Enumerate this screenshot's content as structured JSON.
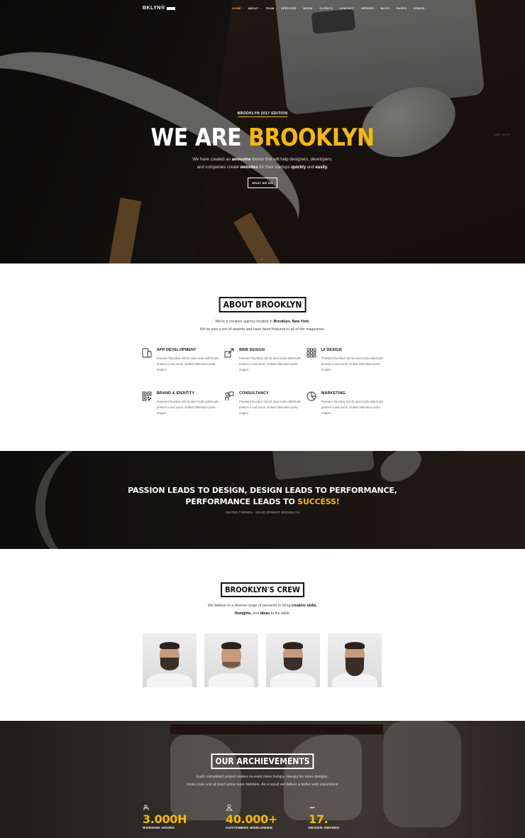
{
  "nav": {
    "logo": "BKLYN",
    "logo_suffix": "®",
    "items": [
      "HOME",
      "ABOUT",
      "TEAM",
      "SERVICES",
      "WORK",
      "CLIENTS",
      "CONTACT",
      "HEROES",
      "BLOG",
      "PAGES",
      "DEMOS"
    ],
    "active": "HOME"
  },
  "hero": {
    "edition": "BROOKLYN 2017 EDITION",
    "title_plain": "WE ARE ",
    "title_highlight": "BROOKLYN",
    "sub": {
      "line1_a": "We have created an ",
      "line1_b": "awesome",
      "line1_c": " theme that will help designers, developers,",
      "line2_a": "and companies create ",
      "line2_b": "websites",
      "line2_c": " for their startups ",
      "line2_d": "quickly",
      "line2_e": " and ",
      "line2_f": "easily."
    },
    "button": "WHAT WE DO",
    "side_label": "SEE NEXT",
    "scroll_icon": "chevron-down-icon",
    "accent": "#f5b80c"
  },
  "about": {
    "title": "ABOUT BROOKLYN",
    "line1_a": "We're a creative agency located in ",
    "line1_b": "Brooklyn, New York.",
    "line2": "We've won a ton of awards and have been featured in all of the magazines.",
    "services": [
      {
        "icon": "mobile-devices-icon",
        "title": "APP DEVELOPMENT",
        "text": "Praesent faucibus nisl sit amet nulla sollicitudin pretium a sed purus. Nullam bibendum porta magna."
      },
      {
        "icon": "resize-arrow-icon",
        "title": "WEB DESIGN",
        "text": "Praesent faucibus nisl sit amet nulla sollicitudin pretium a sed purus. Nullam bibendum porta magna."
      },
      {
        "icon": "grid-icon",
        "title": "UI DESIGN",
        "text": "Praesent faucibus nisl sit amet nulla sollicitudin pretium a sed purus. Nullam bibendum porta magna."
      },
      {
        "icon": "qr-code-icon",
        "title": "BRAND & IDENTITY",
        "text": "Praesent faucibus nisl sit amet nulla sollicitudin pretium a sed purus. Nullam bibendum porta magna."
      },
      {
        "icon": "presenter-icon",
        "title": "CONSULTANCY",
        "text": "Praesent faucibus nisl sit amet nulla sollicitudin pretium a sed purus. Nullam bibendum porta magna."
      },
      {
        "icon": "pie-chart-icon",
        "title": "MARKETING",
        "text": "Praesent faucibus nisl sit amet nulla sollicitudin pretium a sed purus. Nullam bibendum porta magna."
      }
    ]
  },
  "quote": {
    "line1": "PASSION LEADS TO DESIGN, DESIGN LEADS TO PERFORMANCE,",
    "line2_plain": "PERFORMANCE LEADS TO ",
    "line2_highlight": "SUCCESS!",
    "cite": "UNITED THEMES - DEVELOPMENT BROOKLYN"
  },
  "crew": {
    "title": "BROOKLYN'S CREW",
    "line1_a": "We believe in a diverse range of personel to bring ",
    "line1_b": "creative skills,",
    "line2_a": "thoughts,",
    "line2_b": " and ",
    "line2_c": "ideas",
    "line2_d": " to the table.",
    "members": [
      "member-1",
      "member-2",
      "member-3",
      "member-4"
    ]
  },
  "achievements": {
    "title": "OUR ARCHIEVEMENTS",
    "line1": "Each completed project makes us even more hungry. Hungry for more designs,",
    "line2": "more code and at least some more twinkies. As a result we deliver a better web experience",
    "stats": [
      {
        "icon": "desk-icon",
        "value": "3.000H",
        "label": "WORKING HOURS"
      },
      {
        "icon": "globe-user-icon",
        "value": "40.000+",
        "label": "CUSTOMERS WORLDWIDE"
      },
      {
        "icon": "mustache-icon",
        "value": "17.",
        "label": "DESIGN AWARDS"
      }
    ]
  }
}
